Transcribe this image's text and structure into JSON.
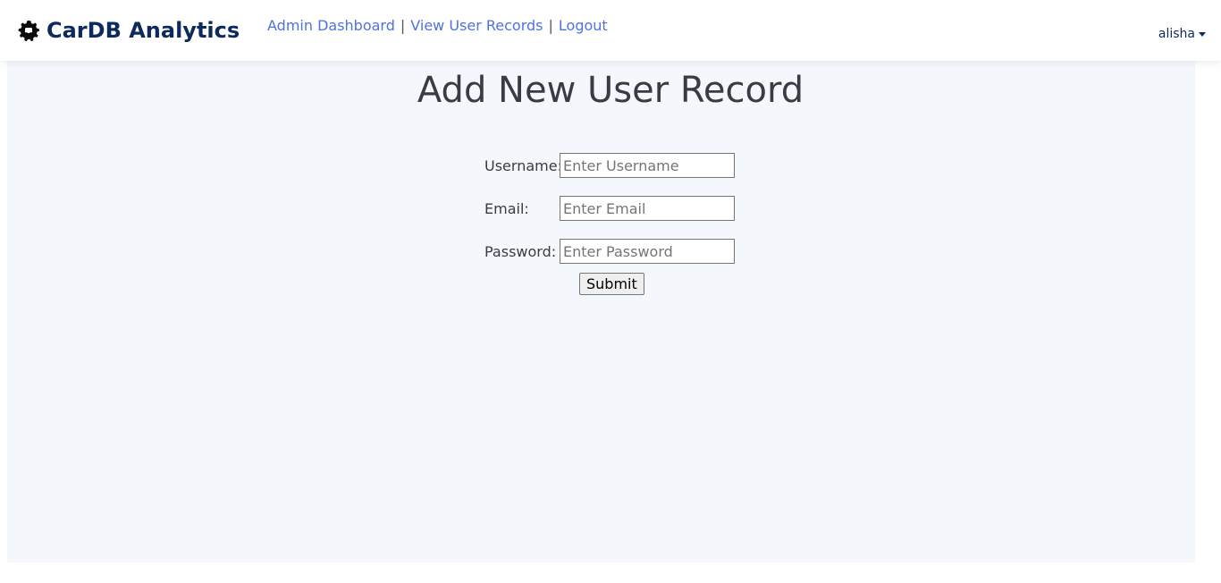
{
  "header": {
    "brand_name": "CarDB Analytics",
    "brand_icon": "gear-car-icon",
    "nav_links": [
      {
        "label": "Admin Dashboard"
      },
      {
        "label": "View User Records"
      },
      {
        "label": "Logout"
      }
    ],
    "separator": "|",
    "user": "alisha"
  },
  "main": {
    "title": "Add New User Record",
    "fields": [
      {
        "label": "Username:",
        "placeholder": "Enter Username",
        "value": ""
      },
      {
        "label": "Email:",
        "placeholder": "Enter Email",
        "value": ""
      },
      {
        "label": "Password:",
        "placeholder": "Enter Password",
        "value": ""
      }
    ],
    "submit_label": "Submit"
  },
  "colors": {
    "brand": "#0d2a5c",
    "link": "#4e73df",
    "content_bg": "#f4f8fd"
  }
}
